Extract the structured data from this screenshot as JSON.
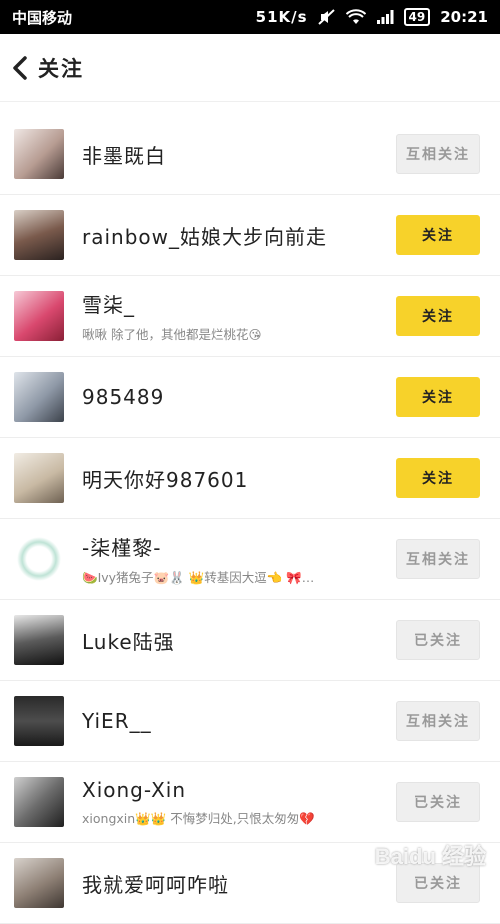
{
  "status_bar": {
    "carrier": "中国移动",
    "speed": "51K/s",
    "battery": "49",
    "time": "20:21"
  },
  "header": {
    "title": "关注"
  },
  "users": [
    {
      "name": "非墨既白",
      "bio": "",
      "button": "互相关注",
      "state": "mutual"
    },
    {
      "name": "rainbow_姑娘大步向前走",
      "bio": "",
      "button": "关注",
      "state": "follow"
    },
    {
      "name": "雪柒_",
      "bio": "啾啾    除了他，其他都是烂桃花😘",
      "button": "关注",
      "state": "follow"
    },
    {
      "name": "985489",
      "bio": "",
      "button": "关注",
      "state": "follow"
    },
    {
      "name": "明天你好987601",
      "bio": "",
      "button": "关注",
      "state": "follow"
    },
    {
      "name": "-柒槿黎-",
      "bio": "🍉Ivy猪兔子🐷🐰 👑转基因大逗👈 🎀…",
      "button": "互相关注",
      "state": "mutual"
    },
    {
      "name": "Luke陆强",
      "bio": "",
      "button": "已关注",
      "state": "followed"
    },
    {
      "name": "YiER__",
      "bio": "",
      "button": "互相关注",
      "state": "mutual"
    },
    {
      "name": "Xiong-Xin",
      "bio": "xiongxin👑👑    不悔梦归处,只恨太匆匆💔",
      "button": "已关注",
      "state": "followed"
    },
    {
      "name": "我就爱呵呵咋啦",
      "bio": "",
      "button": "已关注",
      "state": "followed"
    }
  ],
  "colors": {
    "follow": "#f7d22a",
    "muted": "#efefef"
  },
  "watermark": "Baidu 经验"
}
